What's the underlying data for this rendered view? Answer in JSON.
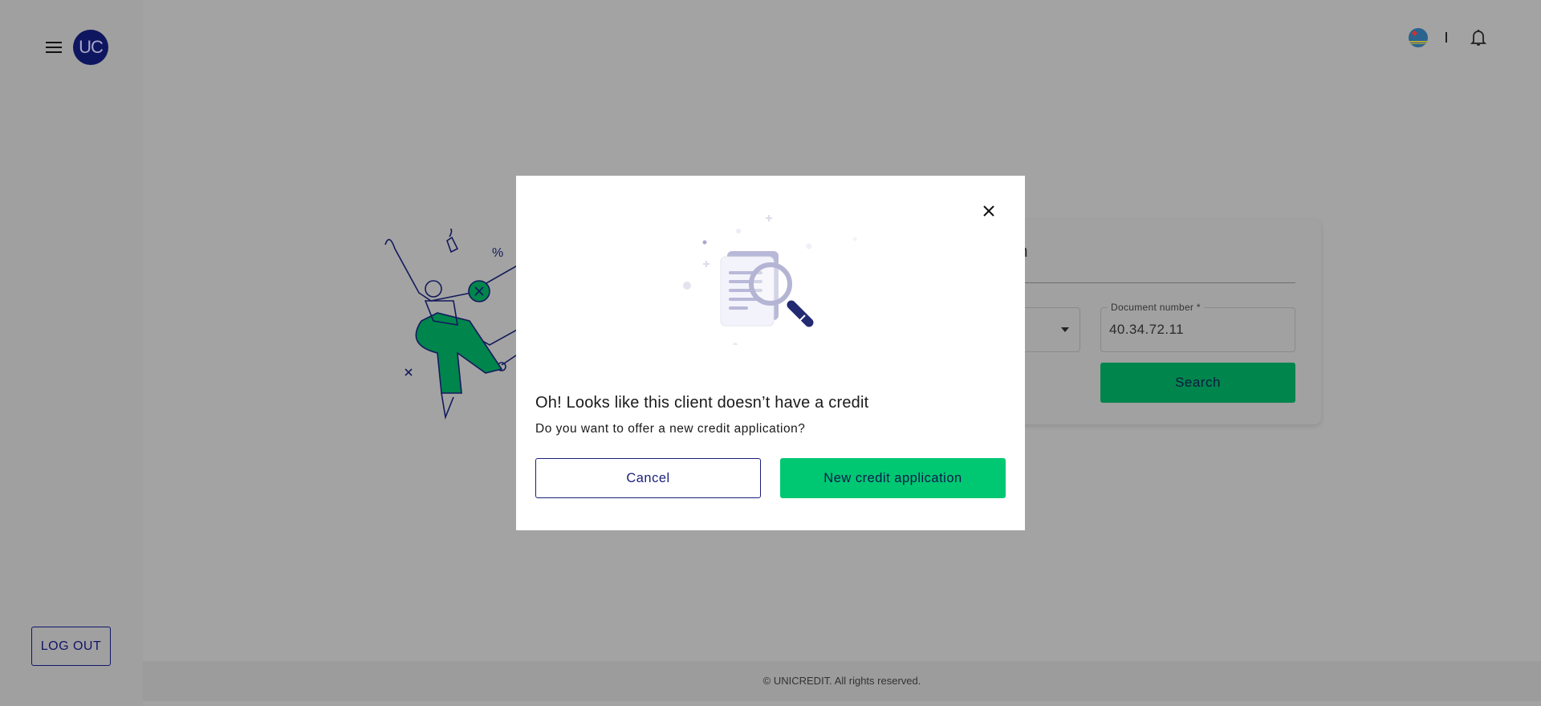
{
  "sidebar": {
    "logo_text": "UC",
    "logout_label": "LOG OUT"
  },
  "header": {
    "flag": "aruba-flag-icon",
    "notifications": "bell-icon"
  },
  "search_card": {
    "title": "Search",
    "title_visible": "earch",
    "document_label": "Document number *",
    "document_value": "40.34.72.11",
    "search_label": "Search"
  },
  "modal": {
    "title": "Oh! Looks like this client doesn’t have a credit",
    "subtitle": "Do you want to offer a new credit application?",
    "cancel_label": "Cancel",
    "confirm_label": "New credit application"
  },
  "footer": {
    "text": "© UNICREDIT. All rights reserved."
  },
  "colors": {
    "brand_navy": "#0f1660",
    "accent_green": "#00c872",
    "overlay_gray": "#a0a0a0"
  }
}
